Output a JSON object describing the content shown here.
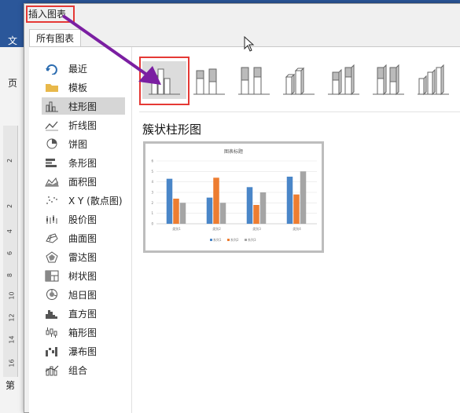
{
  "background": {
    "ruler_numbers": [
      "2",
      "2",
      "4",
      "6",
      "8",
      "10",
      "12",
      "14",
      "16"
    ],
    "left_labels": [
      "文",
      "页",
      "L",
      "第"
    ]
  },
  "dialog": {
    "title": "插入图表",
    "tab_label": "所有图表",
    "subtype_title": "簇状柱形图"
  },
  "sidebar": {
    "items": [
      {
        "label": "最近",
        "icon": "recent-icon"
      },
      {
        "label": "模板",
        "icon": "folder-icon"
      },
      {
        "label": "柱形图",
        "icon": "column-chart-icon"
      },
      {
        "label": "折线图",
        "icon": "line-chart-icon"
      },
      {
        "label": "饼图",
        "icon": "pie-chart-icon"
      },
      {
        "label": "条形图",
        "icon": "bar-chart-icon"
      },
      {
        "label": "面积图",
        "icon": "area-chart-icon"
      },
      {
        "label": "X Y (散点图)",
        "icon": "scatter-chart-icon"
      },
      {
        "label": "股价图",
        "icon": "stock-chart-icon"
      },
      {
        "label": "曲面图",
        "icon": "surface-chart-icon"
      },
      {
        "label": "雷达图",
        "icon": "radar-chart-icon"
      },
      {
        "label": "树状图",
        "icon": "treemap-icon"
      },
      {
        "label": "旭日图",
        "icon": "sunburst-icon"
      },
      {
        "label": "直方图",
        "icon": "histogram-icon"
      },
      {
        "label": "箱形图",
        "icon": "boxplot-icon"
      },
      {
        "label": "瀑布图",
        "icon": "waterfall-icon"
      },
      {
        "label": "组合",
        "icon": "combo-chart-icon"
      }
    ],
    "selected_index": 2
  },
  "subtypes": [
    "簇状柱形图",
    "堆积柱形图",
    "百分比堆积柱形图",
    "三维簇状柱形图",
    "三维堆积柱形图",
    "三维百分比堆积柱形图",
    "三维柱形图"
  ],
  "chart_data": {
    "type": "bar",
    "title": "图表标题",
    "categories": [
      "类别1",
      "类别2",
      "类别3",
      "类别4"
    ],
    "series": [
      {
        "name": "系列1",
        "values": [
          4.3,
          2.5,
          3.5,
          4.5
        ],
        "color": "#4a86c8"
      },
      {
        "name": "系列2",
        "values": [
          2.4,
          4.4,
          1.8,
          2.8
        ],
        "color": "#ed7d31"
      },
      {
        "name": "系列3",
        "values": [
          2,
          2,
          3,
          5
        ],
        "color": "#a5a5a5"
      }
    ],
    "ylim": [
      0,
      6
    ],
    "yticks": [
      "0",
      "1",
      "2",
      "3",
      "4",
      "5",
      "6"
    ],
    "legend": "bottom",
    "grid": true
  },
  "colors": {
    "accent_red": "#e53935",
    "arrow_purple": "#7b1fa2",
    "word_blue": "#2b579a"
  }
}
